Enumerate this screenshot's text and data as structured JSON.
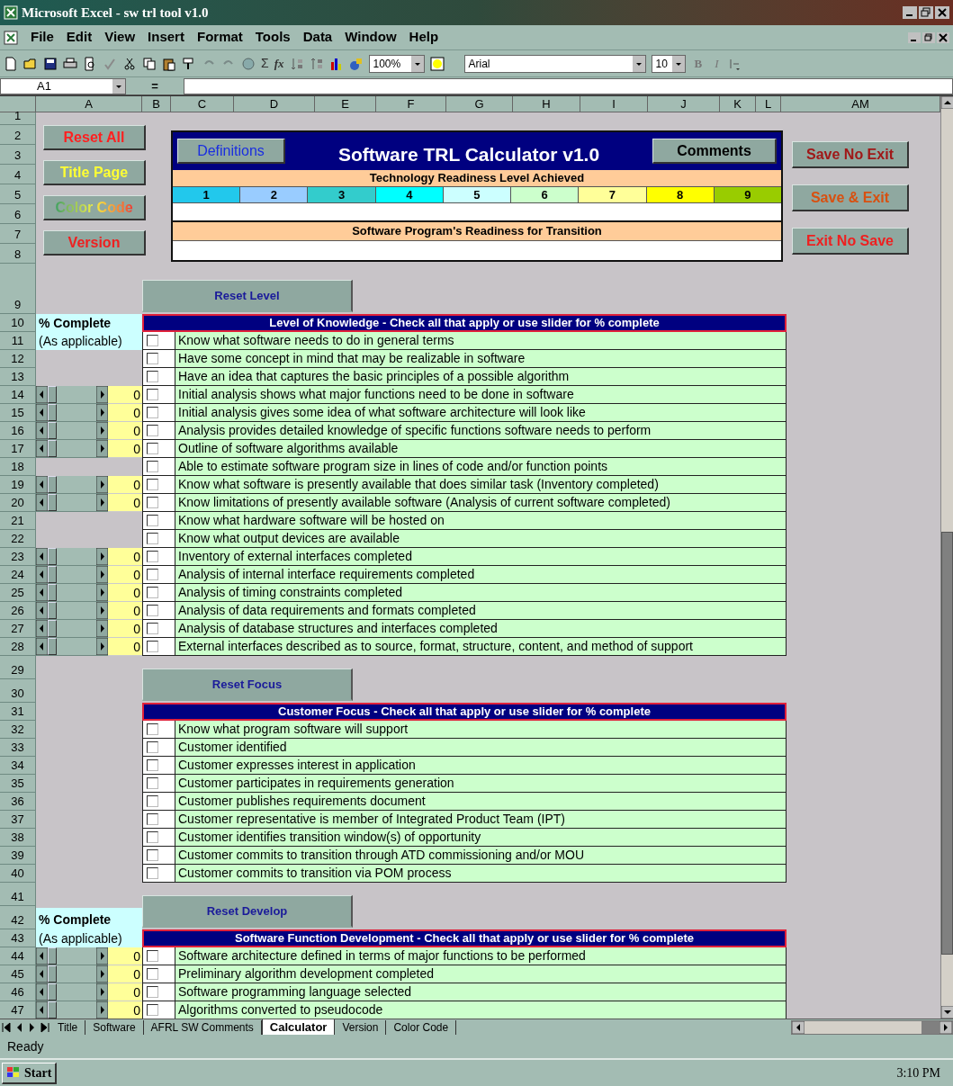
{
  "window": {
    "title": "Microsoft Excel - sw trl tool v1.0"
  },
  "menu": [
    "File",
    "Edit",
    "View",
    "Insert",
    "Format",
    "Tools",
    "Data",
    "Window",
    "Help"
  ],
  "toolbar": {
    "autosum": "Σ",
    "function": "fx",
    "zoom": "100%",
    "font": "Arial",
    "font_size": "10",
    "bold": "B",
    "italic": "I"
  },
  "formula_bar": {
    "name_box": "A1",
    "equals": "="
  },
  "columns": [
    "A",
    "B",
    "C",
    "D",
    "E",
    "F",
    "G",
    "H",
    "I",
    "J",
    "K",
    "L",
    "AM"
  ],
  "header": {
    "rows": [
      "1",
      "2",
      "3",
      "4",
      "5",
      "6",
      "7",
      "8"
    ],
    "left_buttons": [
      {
        "label": "Reset All",
        "kind": "plain"
      },
      {
        "label": "Title Page",
        "kind": "plain"
      },
      {
        "label": "Color Code",
        "kind": "multicolor"
      },
      {
        "label": "Version",
        "kind": "plain"
      }
    ],
    "definitions": "Definitions",
    "title": "Software TRL Calculator v1.0",
    "comments": "Comments",
    "trl_heading": "Technology Readiness Level Achieved",
    "levels": [
      {
        "label": "1",
        "color": "#22c8ec"
      },
      {
        "label": "2",
        "color": "#99ccff"
      },
      {
        "label": "3",
        "color": "#33cccc"
      },
      {
        "label": "4",
        "color": "#00ffff"
      },
      {
        "label": "5",
        "color": "#ccffff"
      },
      {
        "label": "6",
        "color": "#ccffcc"
      },
      {
        "label": "7",
        "color": "#ffff99"
      },
      {
        "label": "8",
        "color": "#ffff00"
      },
      {
        "label": "9",
        "color": "#99cc00"
      }
    ],
    "readiness_heading": "Software Program's Readiness for Transition",
    "right_buttons": [
      {
        "label": "Save No Exit"
      },
      {
        "label": "Save & Exit"
      },
      {
        "label": "Exit No Save"
      }
    ]
  },
  "sections": [
    {
      "kind": "reset",
      "rows": [
        "9"
      ],
      "button": "Reset Level"
    },
    {
      "kind": "checklist",
      "heading_row": "10",
      "heading": "Level of Knowledge - Check all that apply or use slider for % complete",
      "side_labels": [
        "% Complete",
        "(As applicable)"
      ],
      "items": [
        {
          "row": "11",
          "checked": false,
          "text": "Know what software needs to do in general terms"
        },
        {
          "row": "12",
          "checked": false,
          "text": "Have some concept in mind that may be realizable in software"
        },
        {
          "row": "13",
          "checked": false,
          "text": "Have an idea that captures the basic principles of a possible algorithm"
        },
        {
          "row": "14",
          "checked": false,
          "text": "Initial analysis shows what major functions need to be done in software",
          "slider": {
            "level": 0,
            "value": "0"
          }
        },
        {
          "row": "15",
          "checked": false,
          "text": "Initial analysis gives some idea of what software architecture will look like",
          "slider": {
            "level": 0,
            "value": "0"
          }
        },
        {
          "row": "16",
          "checked": false,
          "text": "Analysis provides detailed knowledge of specific functions software needs to perform",
          "slider": {
            "level": 0,
            "value": "0"
          }
        },
        {
          "row": "17",
          "checked": false,
          "text": "Outline of software algorithms available",
          "slider": {
            "level": 0,
            "value": "0"
          }
        },
        {
          "row": "18",
          "checked": false,
          "text": "Able to estimate software program size in lines of code and/or function points"
        },
        {
          "row": "19",
          "checked": false,
          "text": "Know what software is presently available that does similar task (Inventory completed)",
          "slider": {
            "level": 0,
            "value": "0"
          }
        },
        {
          "row": "20",
          "checked": false,
          "text": "Know limitations of presently available software (Analysis of current software completed)",
          "slider": {
            "level": 0,
            "value": "0"
          }
        },
        {
          "row": "21",
          "checked": false,
          "text": "Know what hardware software will be hosted on"
        },
        {
          "row": "22",
          "checked": false,
          "text": "Know what output devices are available"
        },
        {
          "row": "23",
          "checked": false,
          "text": "Inventory of external interfaces completed",
          "slider": {
            "level": 0,
            "value": "0"
          }
        },
        {
          "row": "24",
          "checked": false,
          "text": "Analysis of internal interface requirements completed",
          "slider": {
            "level": 0,
            "value": "0"
          }
        },
        {
          "row": "25",
          "checked": false,
          "text": "Analysis of timing constraints completed",
          "slider": {
            "level": 0,
            "value": "0"
          }
        },
        {
          "row": "26",
          "checked": false,
          "text": "Analysis of data requirements and formats completed",
          "slider": {
            "level": 0,
            "value": "0"
          }
        },
        {
          "row": "27",
          "checked": false,
          "text": "Analysis of database structures and interfaces completed",
          "slider": {
            "level": 0,
            "value": "0"
          }
        },
        {
          "row": "28",
          "checked": false,
          "text": "External interfaces described as to source, format, structure, content, and method of support",
          "slider": {
            "level": 0,
            "value": "0"
          }
        }
      ]
    },
    {
      "kind": "reset",
      "rows": [
        "29",
        "30"
      ],
      "button": "Reset Focus"
    },
    {
      "kind": "checklist",
      "heading_row": "31",
      "heading": "Customer Focus - Check all that apply or use slider for % complete",
      "items": [
        {
          "row": "32",
          "checked": false,
          "text": "Know what program software will support"
        },
        {
          "row": "33",
          "checked": false,
          "text": "Customer identified"
        },
        {
          "row": "34",
          "checked": false,
          "text": "Customer expresses interest in application"
        },
        {
          "row": "35",
          "checked": false,
          "text": "Customer participates in requirements generation"
        },
        {
          "row": "36",
          "checked": false,
          "text": "Customer publishes requirements document"
        },
        {
          "row": "37",
          "checked": false,
          "text": "Customer representative is member of Integrated Product Team (IPT)"
        },
        {
          "row": "38",
          "checked": false,
          "text": "Customer identifies transition window(s) of opportunity"
        },
        {
          "row": "39",
          "checked": false,
          "text": "Customer commits to transition through ATD commissioning and/or MOU"
        },
        {
          "row": "40",
          "checked": false,
          "text": "Customer commits to transition via POM process"
        }
      ]
    },
    {
      "kind": "reset",
      "rows": [
        "41",
        "42"
      ],
      "button": "Reset Develop",
      "side_label": "% Complete"
    },
    {
      "kind": "checklist",
      "heading_row": "43",
      "heading": "Software Function Development - Check all that apply or use slider for % complete",
      "side_labels": [
        "(As applicable)"
      ],
      "items": [
        {
          "row": "44",
          "checked": false,
          "text": "Software architecture defined in terms of major functions to be performed",
          "slider": {
            "level": 0,
            "value": "0"
          }
        },
        {
          "row": "45",
          "checked": false,
          "text": "Preliminary algorithm development completed",
          "slider": {
            "level": 0,
            "value": "0"
          }
        },
        {
          "row": "46",
          "checked": false,
          "text": "Software programming language selected",
          "slider": {
            "level": 0,
            "value": "0"
          }
        },
        {
          "row": "47",
          "checked": false,
          "text": "Algorithms converted to pseudocode",
          "slider": {
            "level": 0,
            "value": "0"
          }
        }
      ]
    }
  ],
  "sheet_tabs": [
    {
      "label": "Title",
      "selected": false
    },
    {
      "label": "Software",
      "selected": false
    },
    {
      "label": "AFRL SW Comments",
      "selected": false
    },
    {
      "label": "Calculator",
      "selected": true
    },
    {
      "label": "Version",
      "selected": false
    },
    {
      "label": "Color Code",
      "selected": false
    }
  ],
  "status_bar": {
    "text": "Ready"
  },
  "taskbar": {
    "start": "Start",
    "clock": "3:10 PM"
  }
}
